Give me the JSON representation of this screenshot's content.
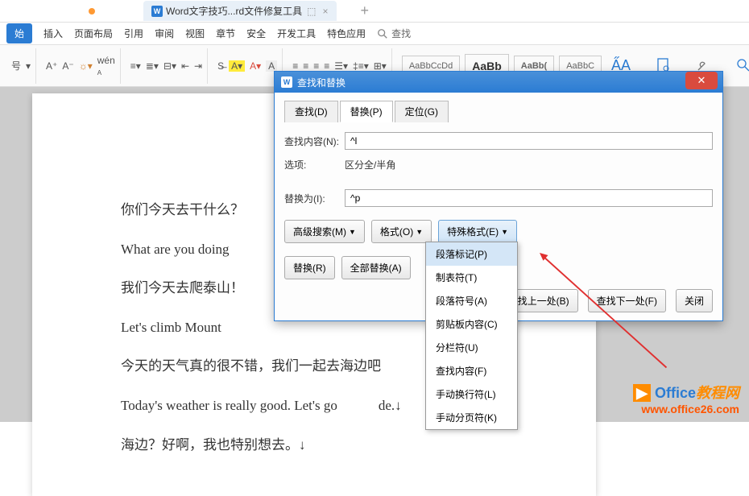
{
  "titlebar": {
    "doc_tab": "Word文字技巧...rd文件修复工具",
    "new_tab": "+"
  },
  "menu": {
    "start": "始",
    "items": [
      "插入",
      "页面布局",
      "引用",
      "审阅",
      "视图",
      "章节",
      "安全",
      "开发工具",
      "特色应用"
    ],
    "search": "查找"
  },
  "toolbar": {
    "font_size_label": "号",
    "styles": [
      "AaBbCcDd",
      "AaBb",
      "AaBb(",
      "AaBbC"
    ],
    "aa_icon": "A̋A"
  },
  "doc": {
    "p1": "你们今天去干什么？",
    "p2": "What are you doing",
    "p3": "我们今天去爬泰山！",
    "p4": "Let's climb Mount",
    "p5": "今天的天气真的很不错，我们一起去海边吧",
    "p6": "Today's weather is really good. Let's go            de.↓",
    "p7": "海边？好啊，我也特别想去。↓"
  },
  "dialog": {
    "title": "查找和替换",
    "tabs": {
      "find": "查找(D)",
      "replace": "替换(P)",
      "goto": "定位(G)"
    },
    "find_label": "查找内容(N):",
    "find_value": "^l",
    "options_label": "选项:",
    "options_value": "区分全/半角",
    "replace_label": "替换为(I):",
    "replace_value": "^p",
    "adv_search": "高级搜索(M)",
    "format": "格式(O)",
    "special": "特殊格式(E)",
    "replace_btn": "替换(R)",
    "replace_all": "全部替换(A)",
    "find_prev": "查找上一处(B)",
    "find_next": "查找下一处(F)",
    "close": "关闭"
  },
  "menu_items": {
    "m1": "段落标记(P)",
    "m2": "制表符(T)",
    "m3": "段落符号(A)",
    "m4": "剪贴板内容(C)",
    "m5": "分栏符(U)",
    "m6": "查找内容(F)",
    "m7": "手动换行符(L)",
    "m8": "手动分页符(K)"
  },
  "watermark": {
    "line1_a": "Office",
    "line1_b": "教程网",
    "line2": "www.office26.com"
  }
}
